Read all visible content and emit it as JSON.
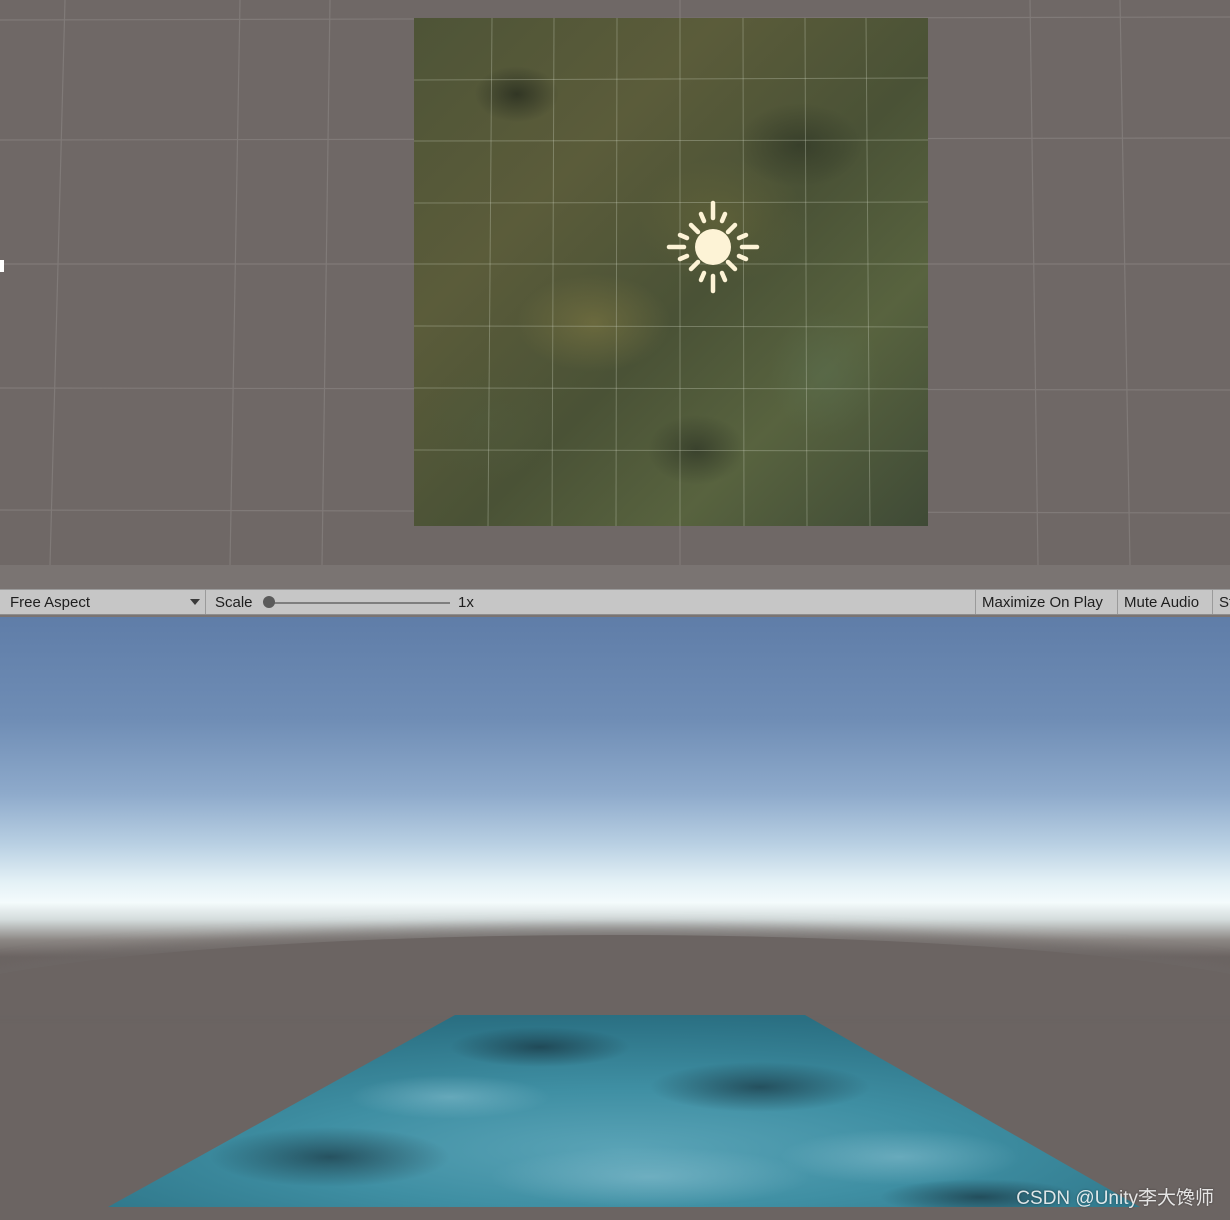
{
  "toolbar": {
    "aspect_label": "Free Aspect",
    "scale_label": "Scale",
    "scale_value": "1x",
    "maximize_label": "Maximize On Play",
    "mute_label": "Mute Audio",
    "stats_label": "Stats"
  },
  "icons": {
    "light": "sun-icon",
    "dropdown": "chevron-down-icon"
  },
  "colors": {
    "scene_background": "#6f6866",
    "terrain": "#4e5437",
    "sun": "#fdf3d6",
    "ground_plane": "#3f8fa3",
    "toolbar": "#c6c6c6"
  },
  "watermark": "CSDN @Unity李大馋师"
}
